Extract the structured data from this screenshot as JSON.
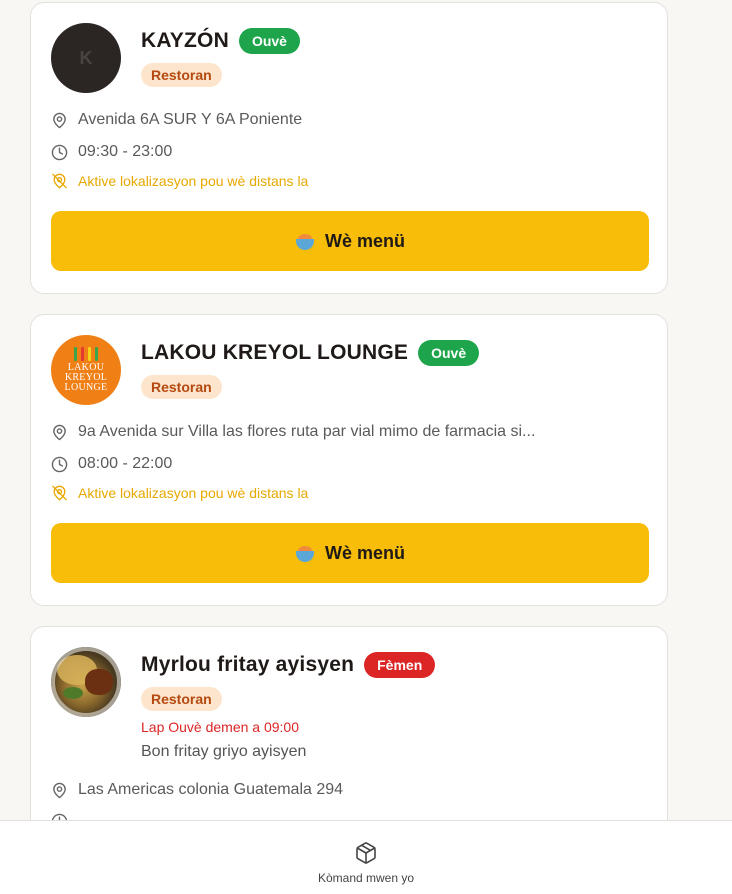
{
  "restaurants": [
    {
      "avatar_letter": "K",
      "name": "KAYZÓN",
      "status": "Ouvè",
      "status_color": "#1ea54c",
      "category": "Restoran",
      "address": "Avenida 6A SUR Y 6A Poniente",
      "hours": "09:30 - 23:00",
      "location_notice": "Aktive lokalizasyon pou wè distans la",
      "menu_button": "Wè menü"
    },
    {
      "logo_text": [
        "LAKOU",
        "KREYOL",
        "LOUNGE"
      ],
      "name": "LAKOU KREYOL LOUNGE",
      "status": "Ouvè",
      "status_color": "#1ea54c",
      "category": "Restoran",
      "address": "9a Avenida sur Villa las flores ruta par vial mimo de farmacia si...",
      "hours": "08:00 - 22:00",
      "location_notice": "Aktive lokalizasyon pou wè distans la",
      "menu_button": "Wè menü"
    },
    {
      "name": "Myrlou fritay ayisyen",
      "status": "Fèmen",
      "status_color": "#dc2626",
      "category": "Restoran",
      "reopen_notice": "Lap Ouvè demen a 09:00",
      "description": "Bon fritay griyo ayisyen",
      "address": "Las Americas colonia Guatemala 294"
    }
  ],
  "bottom_nav": {
    "orders_label": "Kòmand mwen yo",
    "orders_icon": "package-icon"
  },
  "colors": {
    "accent": "#f7bd08",
    "open": "#1ea54c",
    "closed": "#dc2626",
    "tag_bg": "#fde4cc",
    "tag_text": "#b44a10"
  }
}
